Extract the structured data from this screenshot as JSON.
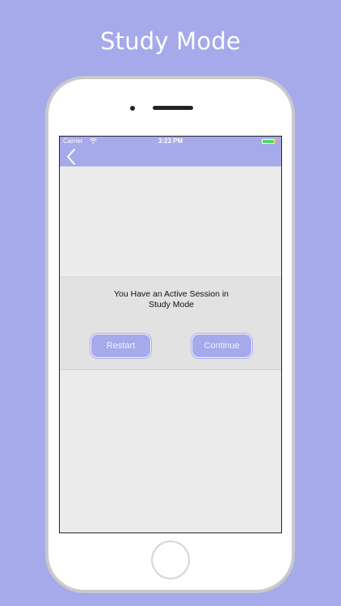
{
  "promo": {
    "headline": "Study Mode"
  },
  "status_bar": {
    "carrier": "Carrier",
    "time": "3:23 PM",
    "wifi_icon": "wifi-icon",
    "battery_icon": "battery-icon"
  },
  "nav_bar": {
    "back_icon": "chevron-left-icon"
  },
  "session_dialog": {
    "message": "You Have an Active Session in Study Mode",
    "restart_label": "Restart",
    "continue_label": "Continue"
  },
  "colors": {
    "background": "#a6a9ea",
    "accent": "#a6a9ea",
    "screen_background": "#ebebeb",
    "panel_background": "#e2e2e2"
  }
}
